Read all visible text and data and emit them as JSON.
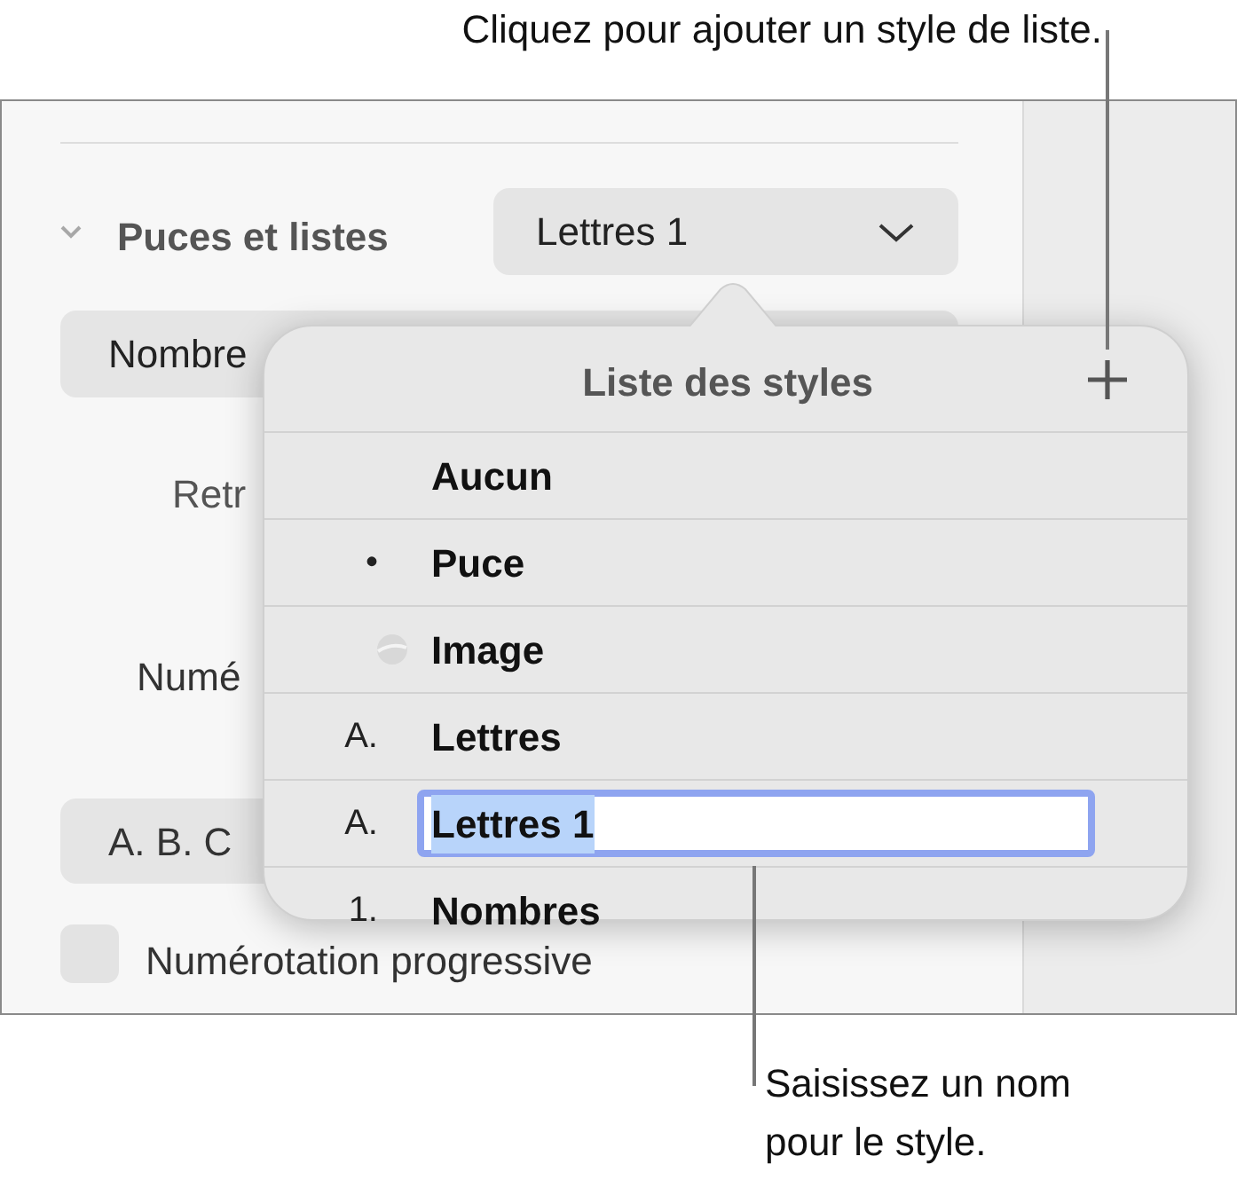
{
  "callouts": [
    {
      "kind": "top",
      "text": "Cliquez pour ajouter un style de liste."
    },
    {
      "kind": "bottom",
      "text": "Saisissez un nom pour le style."
    }
  ],
  "panel": {
    "section": {
      "title": "Puces et listes",
      "expanded": true,
      "dropdown": "Lettres 1"
    },
    "style_button": "Nombre",
    "label_1": "Retr",
    "label_2": "Numé",
    "format_button": "A. B. C",
    "checkbox": {
      "label": "Numérotation progressive",
      "checked": false
    }
  },
  "popover": {
    "title": "Liste des styles",
    "rows": [
      {
        "kind": "no_marker",
        "label": "Aucun",
        "editing": false
      },
      {
        "kind": "text_marker",
        "marker": "•",
        "label": "Puce",
        "editing": false
      },
      {
        "kind": "image_marker",
        "label": "Image",
        "editing": false
      },
      {
        "kind": "text_marker",
        "marker": "A.",
        "label": "Lettres",
        "editing": false
      },
      {
        "kind": "text_marker",
        "marker": "A.",
        "label": "Lettres 1",
        "editing": true,
        "text_selected": true
      },
      {
        "kind": "text_marker",
        "marker": "1.",
        "label": "Nombres",
        "editing": false
      }
    ]
  }
}
